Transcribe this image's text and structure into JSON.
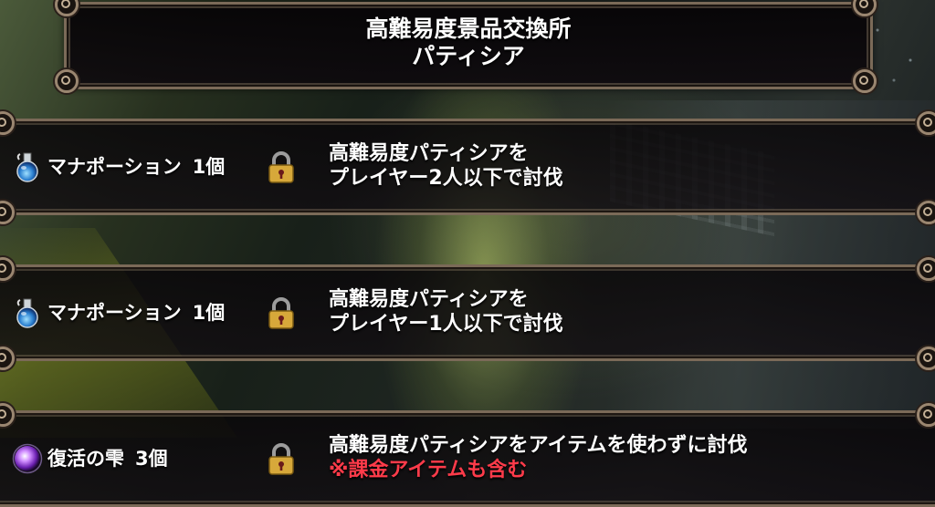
{
  "header": {
    "title_line1": "高難易度景品交換所",
    "title_line2": "パティシア"
  },
  "rewards": [
    {
      "item_icon": "mana-potion-icon",
      "item_name": "マナポーション",
      "quantity": "1個",
      "locked": true,
      "condition_line1": "高難易度パティシアを",
      "condition_line2": "プレイヤー2人以下で討伐"
    },
    {
      "item_icon": "mana-potion-icon",
      "item_name": "マナポーション",
      "quantity": "1個",
      "locked": true,
      "condition_line1": "高難易度パティシアを",
      "condition_line2": "プレイヤー1人以下で討伐"
    },
    {
      "item_icon": "revival-drop-icon",
      "item_name": "復活の雫",
      "quantity": "3個",
      "locked": true,
      "condition_line1": "高難易度パティシアをアイテムを使わずに討伐",
      "condition_line2": "※課金アイテムも含む"
    }
  ],
  "colors": {
    "frame": "#7b6a58",
    "note_red": "#ff3b4a",
    "lock_gold": "#d7a83a"
  }
}
